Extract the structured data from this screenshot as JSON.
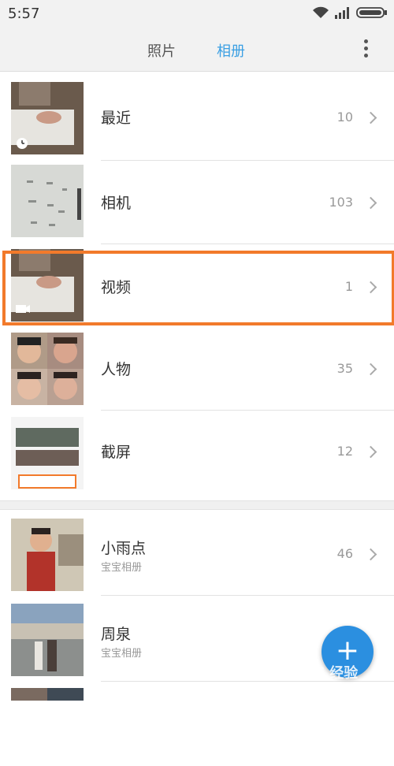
{
  "status": {
    "time": "5:57"
  },
  "header": {
    "tabs": [
      "照片",
      "相册"
    ],
    "active_tab": "相册",
    "accent": "#3a9fe3"
  },
  "albums": [
    {
      "title": "最近",
      "count": "10",
      "badge": "clock-icon"
    },
    {
      "title": "相机",
      "count": "103"
    },
    {
      "title": "视频",
      "count": "1",
      "badge": "video-icon",
      "highlighted": true
    },
    {
      "title": "人物",
      "count": "35"
    },
    {
      "title": "截屏",
      "count": "12"
    }
  ],
  "baby_albums": [
    {
      "title": "小雨点",
      "subtitle": "宝宝相册",
      "count": "46"
    },
    {
      "title": "周泉",
      "subtitle": "宝宝相册",
      "count": ""
    }
  ],
  "fab": {
    "label": "+",
    "color": "#2b8fe0"
  },
  "watermark": "Bai 经验",
  "highlight_color": "#f27a2b"
}
